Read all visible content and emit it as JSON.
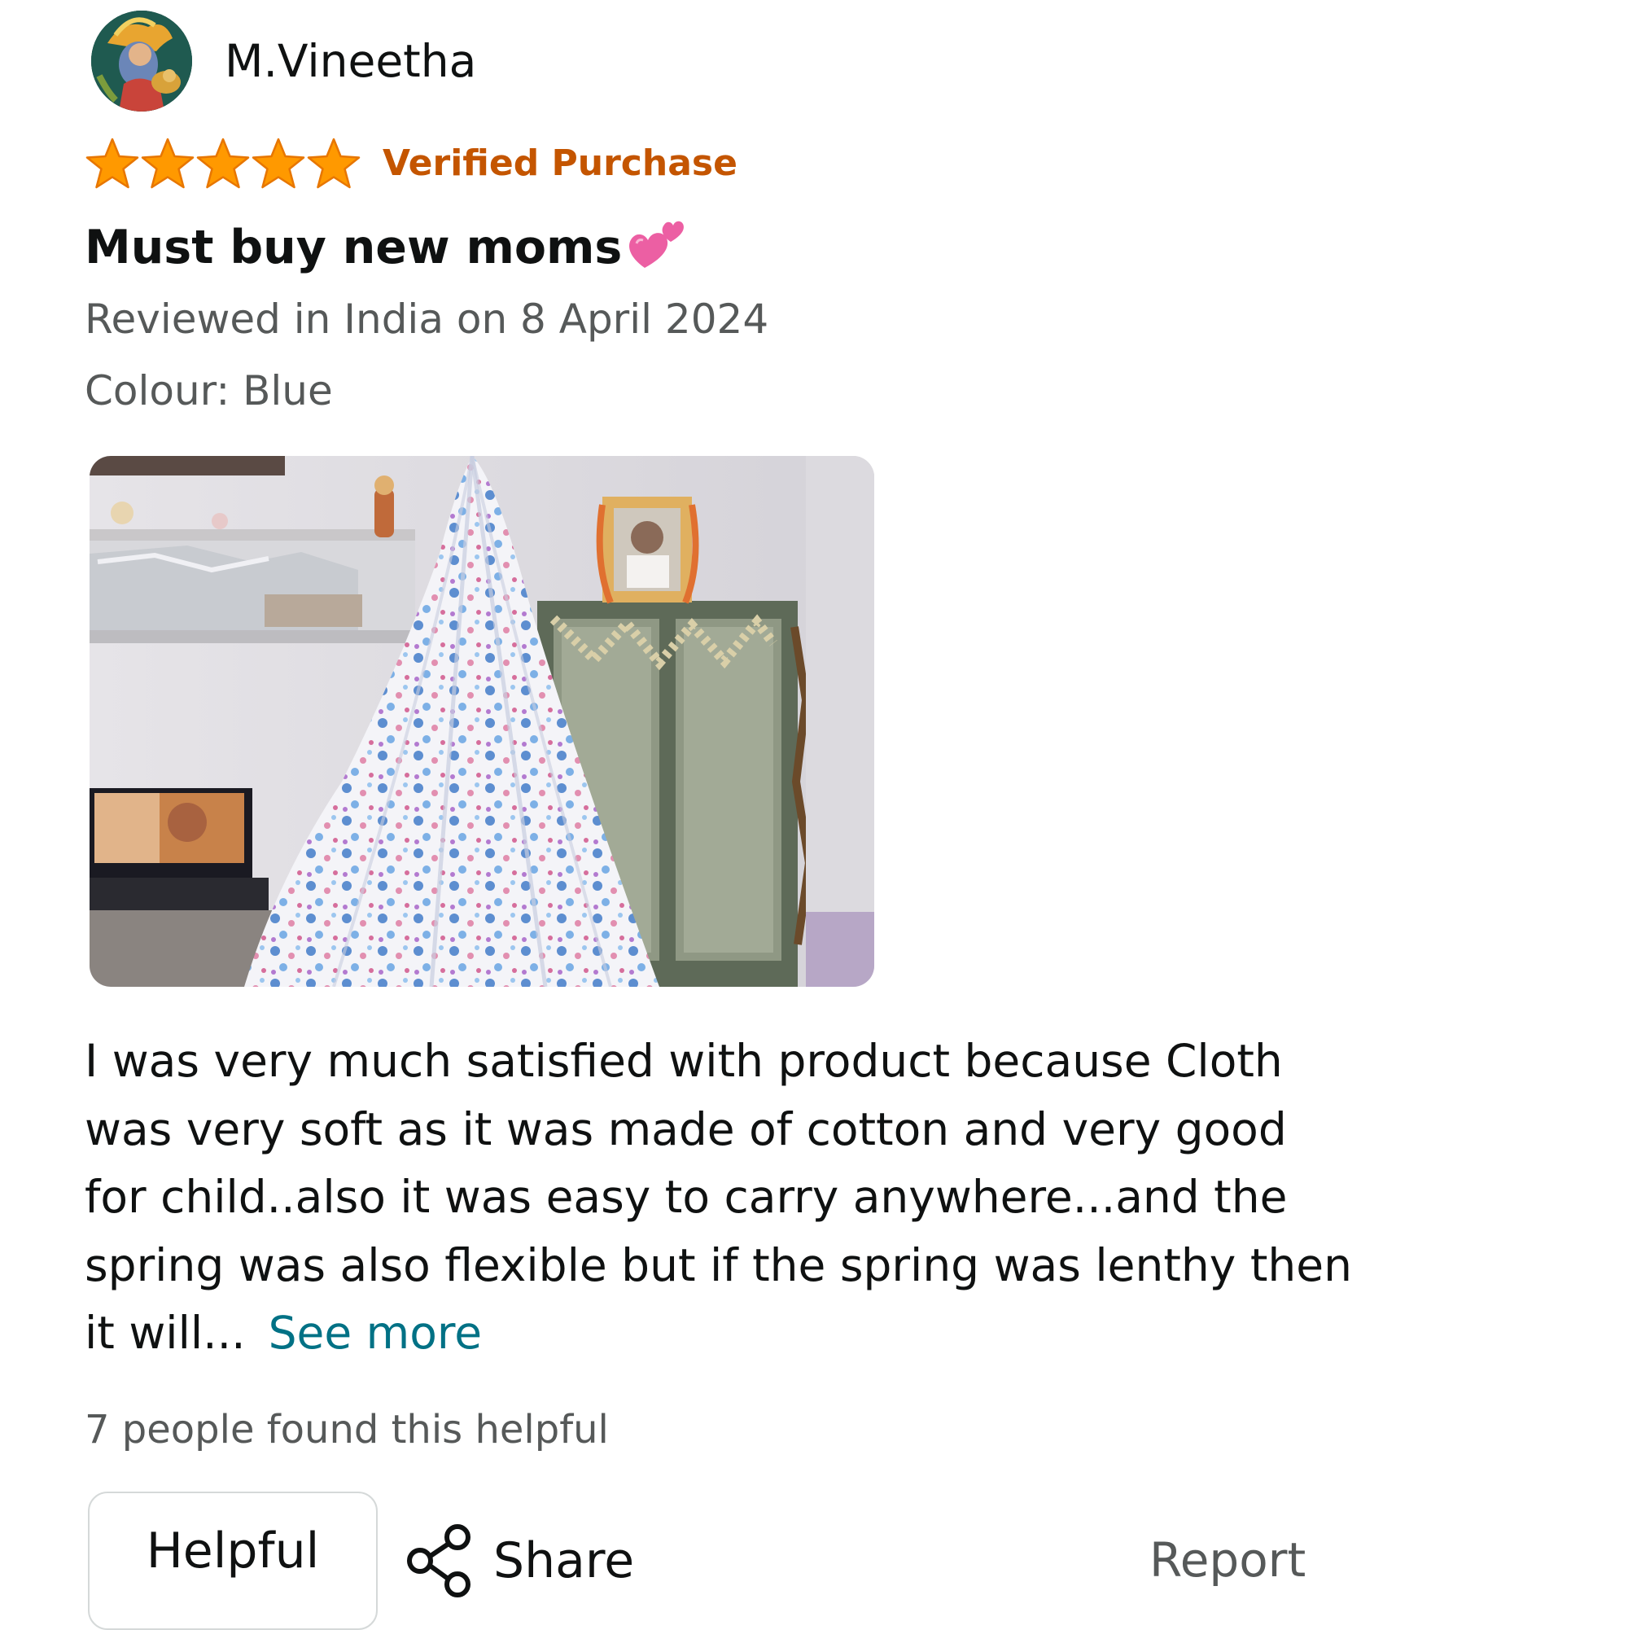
{
  "reviewer": {
    "name": "M.Vineetha",
    "avatar_icon": "avatar-illustration"
  },
  "rating": {
    "stars": 5,
    "max_stars": 5,
    "star_color": "#ff9900",
    "badge": "Verified Purchase",
    "badge_color": "#c45500"
  },
  "review": {
    "title": "Must buy new moms",
    "title_icon": "two-hearts-icon",
    "date": "Reviewed in India on 8 April 2024",
    "variant": "Colour: Blue",
    "photo_icon": "review-photo-cradle",
    "body": "I was very much satisfied with product because Cloth was very soft as it was made of cotton and very good for child..also it was easy to carry anywhere...and the spring was also flexible but if the spring was lenthy then it will...",
    "see_more": "See more",
    "helpful_count": "7 people found this helpful"
  },
  "actions": {
    "helpful": "Helpful",
    "share": "Share",
    "share_icon": "share-icon",
    "report": "Report"
  },
  "colors": {
    "link": "#007185",
    "secondary_text": "#565959",
    "primary_text": "#0f1111"
  }
}
